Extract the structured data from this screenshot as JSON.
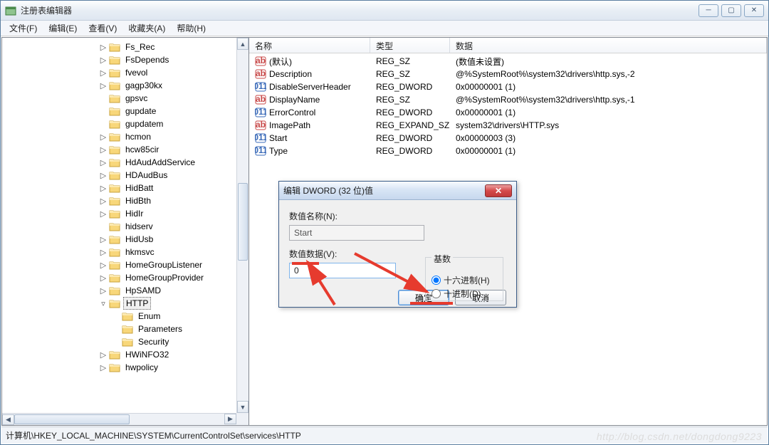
{
  "window": {
    "title": "注册表编辑器"
  },
  "menu": [
    "文件(F)",
    "编辑(E)",
    "查看(V)",
    "收藏夹(A)",
    "帮助(H)"
  ],
  "tree": [
    {
      "indent": 3,
      "exp": "▷",
      "label": "Fs_Rec"
    },
    {
      "indent": 3,
      "exp": "▷",
      "label": "FsDepends"
    },
    {
      "indent": 3,
      "exp": "▷",
      "label": "fvevol"
    },
    {
      "indent": 3,
      "exp": "▷",
      "label": "gagp30kx"
    },
    {
      "indent": 3,
      "exp": "",
      "label": "gpsvc"
    },
    {
      "indent": 3,
      "exp": "",
      "label": "gupdate"
    },
    {
      "indent": 3,
      "exp": "",
      "label": "gupdatem"
    },
    {
      "indent": 3,
      "exp": "▷",
      "label": "hcmon"
    },
    {
      "indent": 3,
      "exp": "▷",
      "label": "hcw85cir"
    },
    {
      "indent": 3,
      "exp": "▷",
      "label": "HdAudAddService"
    },
    {
      "indent": 3,
      "exp": "▷",
      "label": "HDAudBus"
    },
    {
      "indent": 3,
      "exp": "▷",
      "label": "HidBatt"
    },
    {
      "indent": 3,
      "exp": "▷",
      "label": "HidBth"
    },
    {
      "indent": 3,
      "exp": "▷",
      "label": "HidIr"
    },
    {
      "indent": 3,
      "exp": "",
      "label": "hidserv"
    },
    {
      "indent": 3,
      "exp": "▷",
      "label": "HidUsb"
    },
    {
      "indent": 3,
      "exp": "▷",
      "label": "hkmsvc"
    },
    {
      "indent": 3,
      "exp": "▷",
      "label": "HomeGroupListener"
    },
    {
      "indent": 3,
      "exp": "▷",
      "label": "HomeGroupProvider"
    },
    {
      "indent": 3,
      "exp": "▷",
      "label": "HpSAMD"
    },
    {
      "indent": 3,
      "exp": "▿",
      "label": "HTTP",
      "selected": true
    },
    {
      "indent": 4,
      "exp": "",
      "label": "Enum"
    },
    {
      "indent": 4,
      "exp": "",
      "label": "Parameters"
    },
    {
      "indent": 4,
      "exp": "",
      "label": "Security"
    },
    {
      "indent": 3,
      "exp": "▷",
      "label": "HWiNFO32"
    },
    {
      "indent": 3,
      "exp": "▷",
      "label": "hwpolicy"
    }
  ],
  "columns": {
    "name": "名称",
    "type": "类型",
    "data": "数据"
  },
  "rows": [
    {
      "icon": "sz",
      "name": "(默认)",
      "type": "REG_SZ",
      "data": "(数值未设置)"
    },
    {
      "icon": "sz",
      "name": "Description",
      "type": "REG_SZ",
      "data": "@%SystemRoot%\\system32\\drivers\\http.sys,-2"
    },
    {
      "icon": "dw",
      "name": "DisableServerHeader",
      "type": "REG_DWORD",
      "data": "0x00000001 (1)"
    },
    {
      "icon": "sz",
      "name": "DisplayName",
      "type": "REG_SZ",
      "data": "@%SystemRoot%\\system32\\drivers\\http.sys,-1"
    },
    {
      "icon": "dw",
      "name": "ErrorControl",
      "type": "REG_DWORD",
      "data": "0x00000001 (1)"
    },
    {
      "icon": "sz",
      "name": "ImagePath",
      "type": "REG_EXPAND_SZ",
      "data": "system32\\drivers\\HTTP.sys"
    },
    {
      "icon": "dw",
      "name": "Start",
      "type": "REG_DWORD",
      "data": "0x00000003 (3)"
    },
    {
      "icon": "dw",
      "name": "Type",
      "type": "REG_DWORD",
      "data": "0x00000001 (1)"
    }
  ],
  "dialog": {
    "title": "编辑 DWORD (32 位)值",
    "name_label": "数值名称(N):",
    "name_value": "Start",
    "data_label": "数值数据(V):",
    "data_value": "0",
    "base_label": "基数",
    "hex": "十六进制(H)",
    "dec": "十进制(D)",
    "ok": "确定",
    "cancel": "取消"
  },
  "status": "计算机\\HKEY_LOCAL_MACHINE\\SYSTEM\\CurrentControlSet\\services\\HTTP",
  "watermark": "http://blog.csdn.net/dongdong9223"
}
